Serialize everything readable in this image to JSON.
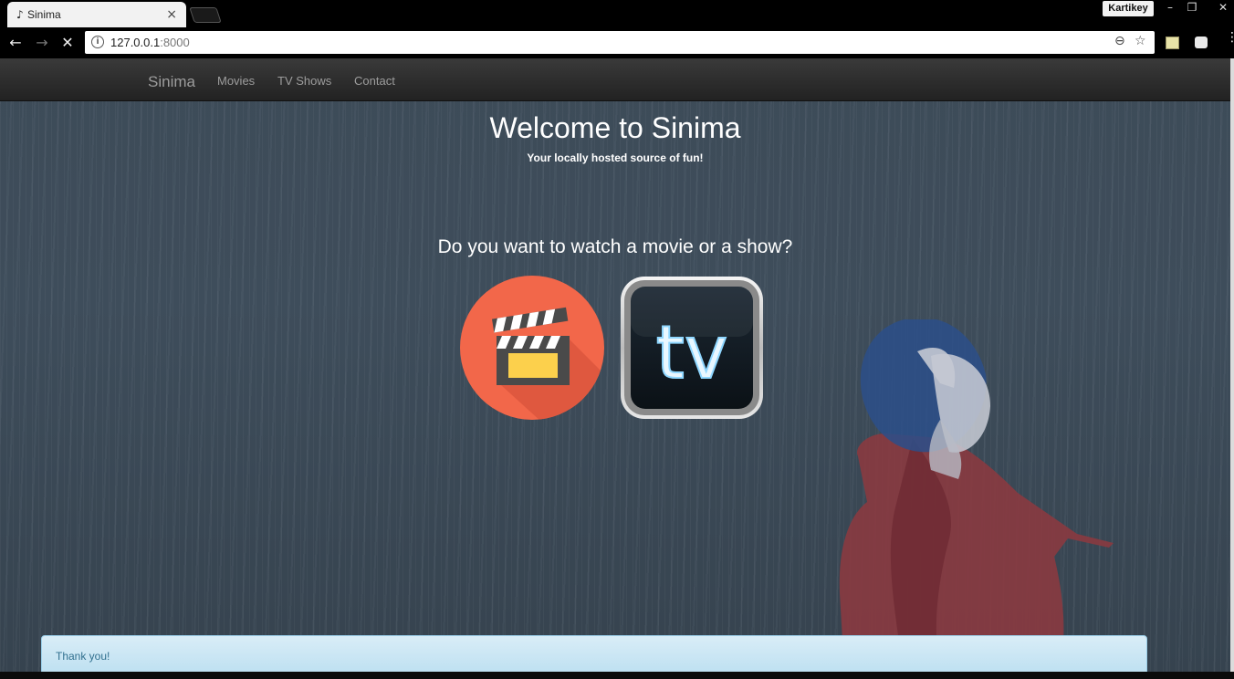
{
  "browser": {
    "tab": {
      "favicon": "♪",
      "title": "Sinima",
      "close": "×"
    },
    "profile_name": "Kartikey",
    "window_controls": {
      "minimize": "–",
      "restore": "❐",
      "close": "✕"
    },
    "nav": {
      "back": "←",
      "forward": "→",
      "stop": "✕"
    },
    "omnibox": {
      "info_glyph": "i",
      "host": "127.0.0.1",
      "port": ":8000",
      "zoom": "⊖",
      "star": "☆"
    },
    "menu": "⋮"
  },
  "site": {
    "navbar": {
      "brand": "Sinima",
      "links": [
        "Movies",
        "TV Shows",
        "Contact"
      ]
    },
    "hero": {
      "title": "Welcome to Sinima",
      "subtitle": "Your locally hosted source of fun!"
    },
    "question": "Do you want to watch a movie or a show?",
    "choices": {
      "tv_text": "tv"
    },
    "alert": "Thank you!"
  },
  "colors": {
    "movie_circle": "#f2674a",
    "clapper_yellow": "#fcd04c",
    "tv_glow": "#8fd7ff",
    "navbar_text": "#9d9d9d"
  }
}
